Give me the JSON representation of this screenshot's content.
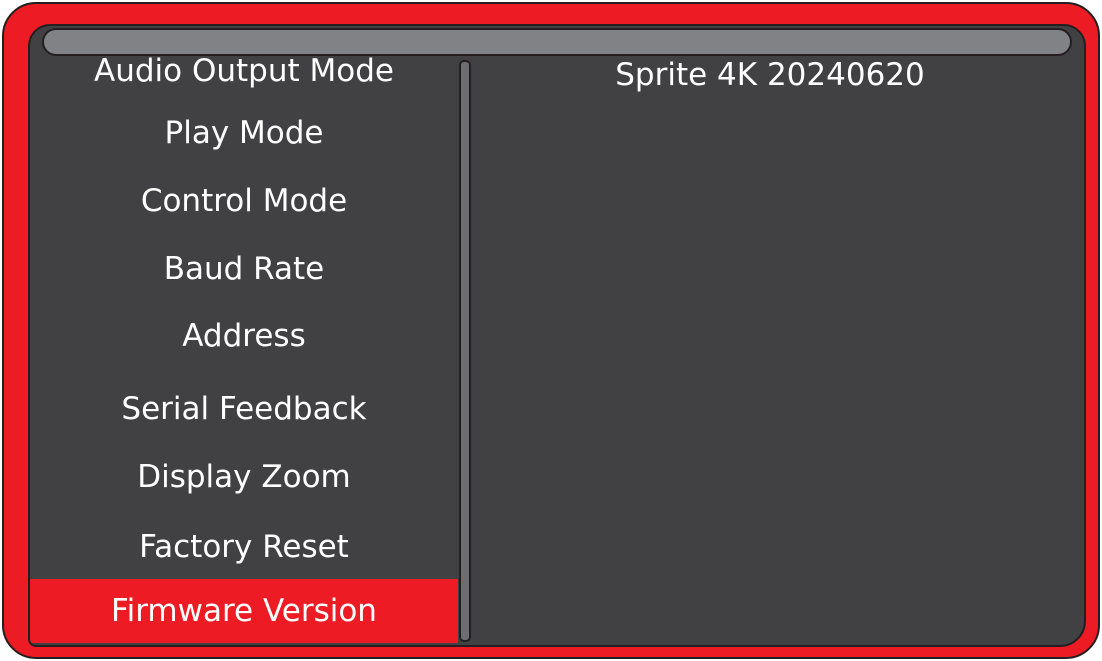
{
  "menu": {
    "items": [
      {
        "label": "Audio Output Mode"
      },
      {
        "label": "Play Mode"
      },
      {
        "label": "Control Mode"
      },
      {
        "label": "Baud Rate"
      },
      {
        "label": "Address"
      },
      {
        "label": "Serial Feedback"
      },
      {
        "label": "Display Zoom"
      },
      {
        "label": "Factory Reset"
      },
      {
        "label": "Firmware Version"
      }
    ],
    "selected": "Firmware Version"
  },
  "detail": {
    "value": "Sprite 4K 20240620"
  },
  "colors": {
    "frame": "#ed1c24",
    "screen": "#414042",
    "title_bar": "#808285",
    "selection": "#ed1c24",
    "text": "#ffffff"
  }
}
